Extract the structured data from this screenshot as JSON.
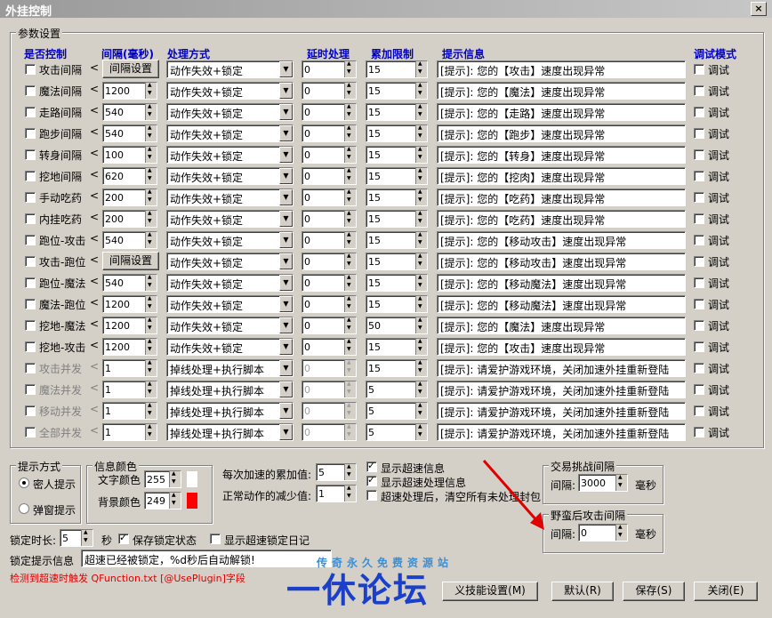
{
  "window": {
    "title": "外挂控制",
    "close": "×"
  },
  "params_group": {
    "label": "参数设置"
  },
  "headers": {
    "enabled": "是否控制",
    "interval": "间隔(毫秒)",
    "method": "处理方式",
    "delay": "延时处理",
    "limit": "累加限制",
    "tip": "提示信息",
    "debug": "调试模式"
  },
  "rows": [
    {
      "label": "攻击间隔",
      "checked": false,
      "disabled": false,
      "interval": "间隔设置",
      "interval_is_button": true,
      "method": "动作失效+锁定",
      "delay": "0",
      "limit": "15",
      "tip": "[提示]: 您的【攻击】速度出现异常",
      "debug": "调试"
    },
    {
      "label": "魔法间隔",
      "checked": false,
      "disabled": false,
      "interval": "1200",
      "method": "动作失效+锁定",
      "delay": "0",
      "limit": "15",
      "tip": "[提示]: 您的【魔法】速度出现异常",
      "debug": "调试"
    },
    {
      "label": "走路间隔",
      "checked": false,
      "disabled": false,
      "interval": "540",
      "method": "动作失效+锁定",
      "delay": "0",
      "limit": "15",
      "tip": "[提示]: 您的【走路】速度出现异常",
      "debug": "调试"
    },
    {
      "label": "跑步间隔",
      "checked": false,
      "disabled": false,
      "interval": "540",
      "method": "动作失效+锁定",
      "delay": "0",
      "limit": "15",
      "tip": "[提示]: 您的【跑步】速度出现异常",
      "debug": "调试"
    },
    {
      "label": "转身间隔",
      "checked": false,
      "disabled": false,
      "interval": "100",
      "method": "动作失效+锁定",
      "delay": "0",
      "limit": "15",
      "tip": "[提示]: 您的【转身】速度出现异常",
      "debug": "调试"
    },
    {
      "label": "挖地间隔",
      "checked": false,
      "disabled": false,
      "interval": "620",
      "method": "动作失效+锁定",
      "delay": "0",
      "limit": "15",
      "tip": "[提示]: 您的【挖肉】速度出现异常",
      "debug": "调试"
    },
    {
      "label": "手动吃药",
      "checked": false,
      "disabled": false,
      "interval": "200",
      "method": "动作失效+锁定",
      "delay": "0",
      "limit": "15",
      "tip": "[提示]: 您的【吃药】速度出现异常",
      "debug": "调试"
    },
    {
      "label": "内挂吃药",
      "checked": false,
      "disabled": false,
      "interval": "200",
      "method": "动作失效+锁定",
      "delay": "0",
      "limit": "15",
      "tip": "[提示]: 您的【吃药】速度出现异常",
      "debug": "调试"
    },
    {
      "label": "跑位-攻击",
      "checked": false,
      "disabled": false,
      "interval": "540",
      "method": "动作失效+锁定",
      "delay": "0",
      "limit": "15",
      "tip": "[提示]: 您的【移动攻击】速度出现异常",
      "debug": "调试"
    },
    {
      "label": "攻击-跑位",
      "checked": false,
      "disabled": false,
      "interval": "间隔设置",
      "interval_is_button": true,
      "method": "动作失效+锁定",
      "delay": "0",
      "limit": "15",
      "tip": "[提示]: 您的【移动攻击】速度出现异常",
      "debug": "调试"
    },
    {
      "label": "跑位-魔法",
      "checked": false,
      "disabled": false,
      "interval": "540",
      "method": "动作失效+锁定",
      "delay": "0",
      "limit": "15",
      "tip": "[提示]: 您的【移动魔法】速度出现异常",
      "debug": "调试"
    },
    {
      "label": "魔法-跑位",
      "checked": false,
      "disabled": false,
      "interval": "1200",
      "method": "动作失效+锁定",
      "delay": "0",
      "limit": "15",
      "tip": "[提示]: 您的【移动魔法】速度出现异常",
      "debug": "调试"
    },
    {
      "label": "挖地-魔法",
      "checked": false,
      "disabled": false,
      "interval": "1200",
      "method": "动作失效+锁定",
      "delay": "0",
      "limit": "50",
      "tip": "[提示]: 您的【魔法】速度出现异常",
      "debug": "调试"
    },
    {
      "label": "挖地-攻击",
      "checked": false,
      "disabled": false,
      "interval": "1200",
      "method": "动作失效+锁定",
      "delay": "0",
      "limit": "15",
      "tip": "[提示]: 您的【攻击】速度出现异常",
      "debug": "调试"
    },
    {
      "label": "攻击并发",
      "checked": false,
      "disabled": true,
      "interval": "1",
      "method": "掉线处理+执行脚本",
      "delay": "0",
      "limit": "15",
      "tip": "[提示]: 请爱护游戏环境，关闭加速外挂重新登陆",
      "debug": "调试"
    },
    {
      "label": "魔法并发",
      "checked": false,
      "disabled": true,
      "interval": "1",
      "method": "掉线处理+执行脚本",
      "delay": "0",
      "limit": "5",
      "tip": "[提示]: 请爱护游戏环境，关闭加速外挂重新登陆",
      "debug": "调试"
    },
    {
      "label": "移动并发",
      "checked": false,
      "disabled": true,
      "interval": "1",
      "method": "掉线处理+执行脚本",
      "delay": "0",
      "limit": "5",
      "tip": "[提示]: 请爱护游戏环境，关闭加速外挂重新登陆",
      "debug": "调试"
    },
    {
      "label": "全部并发",
      "checked": false,
      "disabled": true,
      "interval": "1",
      "method": "掉线处理+执行脚本",
      "delay": "0",
      "limit": "5",
      "tip": "[提示]: 请爱护游戏环境，关闭加速外挂重新登陆",
      "debug": "调试"
    }
  ],
  "prompt_group": {
    "label": "提示方式",
    "option1": "密人提示",
    "option2": "弹窗提示",
    "selected": "option1"
  },
  "color_group": {
    "label": "信息颜色",
    "text_label": "文字颜色",
    "text_value": "255",
    "text_color": "#ffffff",
    "bg_label": "背景颜色",
    "bg_value": "249",
    "bg_color": "#ff0000"
  },
  "accum": {
    "label": "每次加速的累加值:",
    "value": "5"
  },
  "decrease": {
    "label": "正常动作的减少值:",
    "value": "1"
  },
  "show_info": {
    "label": "显示超速信息",
    "checked": true
  },
  "show_process": {
    "label": "显示超速处理信息",
    "checked": true
  },
  "clear_after": {
    "label": "超速处理后，清空所有未处理封包",
    "checked": false
  },
  "trade_group": {
    "label": "交易挑战间隔",
    "interval_label": "间隔:",
    "value": "3000",
    "unit": "毫秒"
  },
  "brute_group": {
    "label": "野蛮后攻击间隔",
    "interval_label": "间隔:",
    "value": "0",
    "unit": "毫秒"
  },
  "lock": {
    "label": "锁定时长:",
    "value": "5",
    "unit": "秒",
    "save_label": "保存锁定状态",
    "save_checked": true,
    "log_label": "显示超速锁定日记",
    "log_checked": false
  },
  "lock_tip": {
    "label": "锁定提示信息",
    "value": "超速已经被锁定，%d秒后自动解锁!"
  },
  "trigger_note": "检测到超速时触发 QFunction.txt [@UsePlugin]字段",
  "buttons": {
    "skill": "义技能设置(M)",
    "default": "默认(R)",
    "save": "保存(S)",
    "close": "关闭(E)"
  },
  "watermark": {
    "top": "传奇永久免费资源站",
    "main": "一休论坛"
  },
  "colors": {
    "header": "#0000c8",
    "trigger": "#e00000",
    "arrow": "#e00000",
    "watermark_main": "#1a3fc8",
    "watermark_top": "#3a8fd8"
  }
}
